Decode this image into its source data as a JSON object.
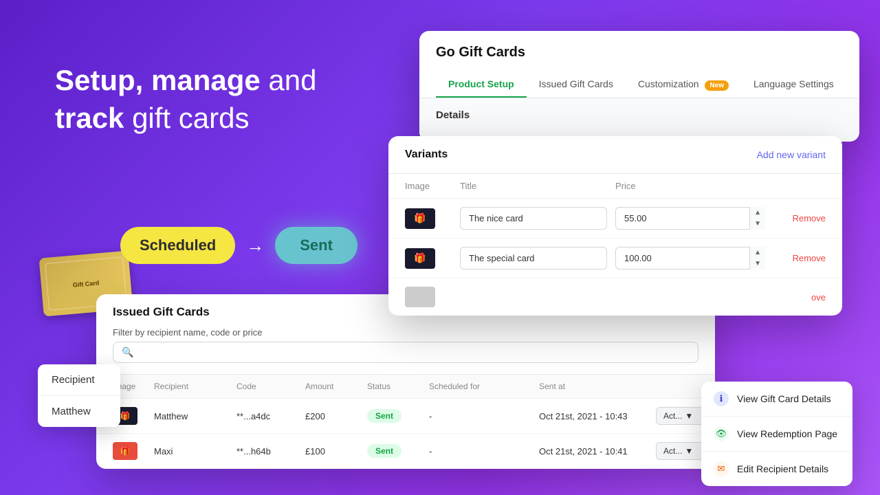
{
  "hero": {
    "line1_bold": "Setup, manage",
    "line1_light": " and",
    "line2_bold": "track",
    "line2_light": " gift cards"
  },
  "status_flow": {
    "scheduled": "Scheduled",
    "arrow": "→",
    "sent": "Sent"
  },
  "app_window": {
    "title": "Go Gift Cards",
    "tabs": [
      {
        "label": "Product Setup",
        "active": true
      },
      {
        "label": "Issued Gift Cards",
        "active": false
      },
      {
        "label": "Customization",
        "active": false,
        "badge": "New"
      },
      {
        "label": "Language Settings",
        "active": false
      }
    ],
    "details_label": "Details"
  },
  "variants": {
    "title": "Variants",
    "add_link": "Add new variant",
    "columns": [
      "Image",
      "Title",
      "Price",
      ""
    ],
    "rows": [
      {
        "emoji": "🎁",
        "title": "The nice card",
        "price": "55.00",
        "remove": "Remove"
      },
      {
        "emoji": "🎁",
        "title": "The special card",
        "price": "100.00",
        "remove": "Remove"
      },
      {
        "emoji": "",
        "title": "",
        "price": "",
        "remove": "ove"
      }
    ]
  },
  "issued": {
    "title": "Issued Gift Cards",
    "filter_label": "Filter by recipient name, code or price",
    "search_placeholder": "",
    "columns": [
      "Image",
      "Recipient",
      "Code",
      "Amount",
      "Status",
      "Scheduled for",
      "Sent at",
      ""
    ],
    "rows": [
      {
        "emoji": "🎁",
        "recipient": "Matthew",
        "code": "**...a4dc",
        "amount": "£200",
        "status": "Sent",
        "scheduled_for": "-",
        "sent_at": "Oct 21st, 2021 - 10:43",
        "action": "Act..."
      },
      {
        "emoji": "🎁",
        "recipient": "Maxi",
        "code": "**...h64b",
        "amount": "£100",
        "status": "Sent",
        "scheduled_for": "-",
        "sent_at": "Oct 21st, 2021 - 10:41",
        "action": "Act..."
      }
    ]
  },
  "recipient_tooltip": {
    "rows": [
      "Recipient",
      "Matthew"
    ]
  },
  "context_menu": {
    "items": [
      {
        "icon": "ℹ",
        "icon_class": "icon-info",
        "label": "View Gift Card Details"
      },
      {
        "icon": "👁",
        "icon_class": "icon-eye",
        "label": "View Redemption Page"
      },
      {
        "icon": "✉",
        "icon_class": "icon-edit",
        "label": "Edit Recipient Details"
      }
    ]
  }
}
